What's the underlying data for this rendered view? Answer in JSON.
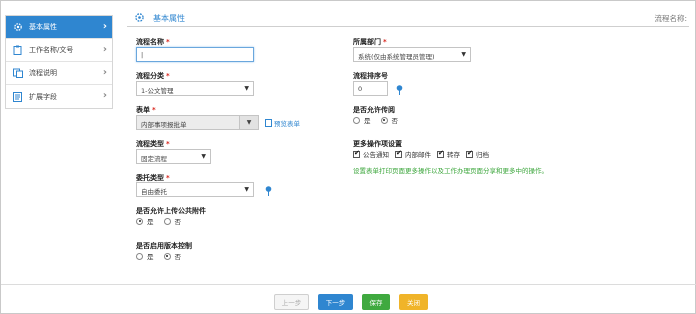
{
  "sidebar": {
    "items": [
      {
        "label": "基本属性",
        "icon": "gear-icon",
        "active": true
      },
      {
        "label": "工作名称/文号",
        "icon": "clipboard-icon",
        "active": false
      },
      {
        "label": "流程说明",
        "icon": "document-icon",
        "active": false
      },
      {
        "label": "扩展字段",
        "icon": "list-icon",
        "active": false
      }
    ]
  },
  "header": {
    "title": "基本属性",
    "right_label": "流程名称:"
  },
  "form": {
    "flow_name": {
      "label": "流程名称",
      "value": "|"
    },
    "flow_category": {
      "label": "流程分类",
      "value": "1-公文管理"
    },
    "form_sheet": {
      "label": "表单",
      "value": "内部事项报批单",
      "preview": "预览表单"
    },
    "flow_type": {
      "label": "流程类型",
      "value": "固定流程"
    },
    "delegate_type": {
      "label": "委托类型",
      "value": "自由委托"
    },
    "allow_attach": {
      "label": "是否允许上传公共附件",
      "yes": "是",
      "no": "否",
      "selected": "yes"
    },
    "version_control": {
      "label": "是否启用版本控制",
      "yes": "是",
      "no": "否",
      "selected": "no"
    },
    "department": {
      "label": "所属部门",
      "value": "系统(仅由系统管理员管理)"
    },
    "sort_no": {
      "label": "流程排序号",
      "value": "0"
    },
    "allow_discussion": {
      "label": "是否允许传阅",
      "yes": "是",
      "no": "否",
      "selected": "no"
    },
    "more_ops": {
      "label": "更多操作项设置",
      "options": [
        {
          "label": "公告通知",
          "checked": true
        },
        {
          "label": "内部邮件",
          "checked": true
        },
        {
          "label": "转存",
          "checked": true
        },
        {
          "label": "归档",
          "checked": true
        }
      ],
      "hint": "设置表单打印页面更多操作以及工作办理页面分享和更多中的操作。"
    }
  },
  "footer": {
    "prev": "上一步",
    "next": "下一步",
    "save": "保存",
    "close": "关闭"
  },
  "colors": {
    "accent": "#2f86d0",
    "required": "#d9251d",
    "save": "#3fa93f",
    "close": "#f0b429",
    "hint": "#3aa53a"
  }
}
